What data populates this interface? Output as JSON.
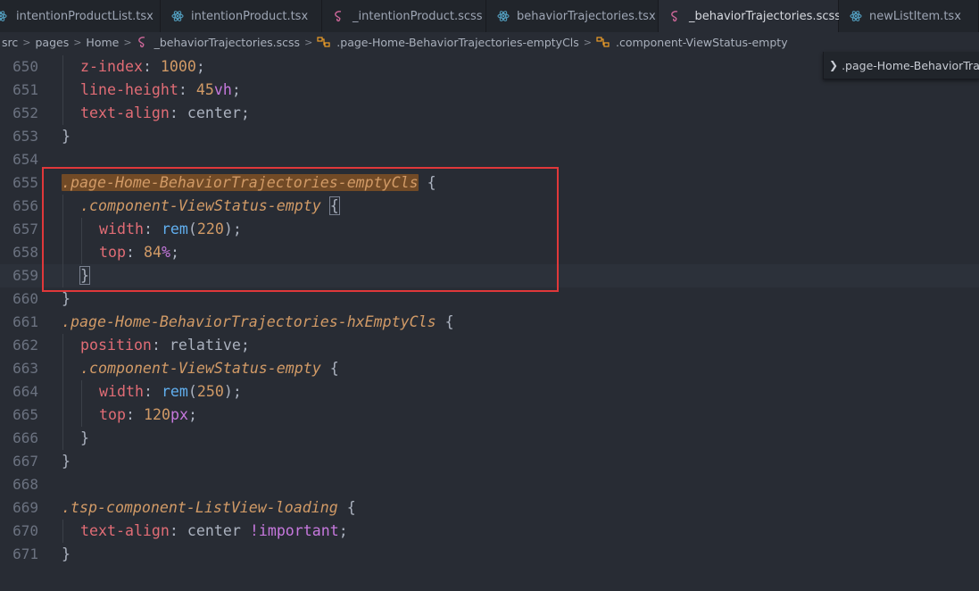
{
  "tabs": [
    {
      "label": "intentionProductList.tsx",
      "icon": "react-icon",
      "active": false
    },
    {
      "label": "intentionProduct.tsx",
      "icon": "react-icon",
      "active": false
    },
    {
      "label": "_intentionProduct.scss",
      "icon": "sass-icon",
      "active": false
    },
    {
      "label": "behaviorTrajectories.tsx",
      "icon": "react-icon",
      "active": false
    },
    {
      "label": "_behaviorTrajectories.scss",
      "icon": "sass-icon",
      "active": true,
      "close": "✕"
    },
    {
      "label": "newListItem.tsx",
      "icon": "react-icon",
      "active": false
    }
  ],
  "breadcrumb": {
    "items": [
      "src",
      "pages",
      "Home",
      "_behaviorTrajectories.scss",
      ".page-Home-BehaviorTrajectories-emptyCls",
      ".component-ViewStatus-empty"
    ],
    "separator": ">"
  },
  "sticky_scroll": {
    "text": ".page-Home-BehaviorTrajectories-emptyCls"
  },
  "editor": {
    "line_numbers": [
      "650",
      "651",
      "652",
      "653",
      "654",
      "655",
      "656",
      "657",
      "658",
      "659",
      "660",
      "661",
      "662",
      "663",
      "664",
      "665",
      "666",
      "667",
      "668",
      "669",
      "670",
      "671"
    ],
    "lines": {
      "l650": {
        "prop": "z-index",
        "num": "1000"
      },
      "l651": {
        "prop": "line-height",
        "num": "45",
        "unit": "vh"
      },
      "l652": {
        "prop": "text-align",
        "val": "center"
      },
      "l653": {
        "close": "}"
      },
      "l655": {
        "selector": ".page-Home-BehaviorTrajectories-emptyCls",
        "open": "{"
      },
      "l656": {
        "selector": ".component-ViewStatus-empty",
        "open": "{"
      },
      "l657": {
        "prop": "width",
        "func": "rem",
        "num": "220"
      },
      "l658": {
        "prop": "top",
        "num": "84",
        "unit": "%"
      },
      "l659": {
        "close": "}"
      },
      "l660": {
        "close": "}"
      },
      "l661": {
        "selector": ".page-Home-BehaviorTrajectories-hxEmptyCls",
        "open": "{"
      },
      "l662": {
        "prop": "position",
        "val": "relative"
      },
      "l663": {
        "selector": ".component-ViewStatus-empty",
        "open": "{"
      },
      "l664": {
        "prop": "width",
        "func": "rem",
        "num": "250"
      },
      "l665": {
        "prop": "top",
        "num": "120",
        "unit": "px"
      },
      "l666": {
        "close": "}"
      },
      "l667": {
        "close": "}"
      },
      "l669": {
        "selector": ".tsp-component-ListView-loading",
        "open": "{"
      },
      "l670": {
        "prop": "text-align",
        "val": "center",
        "important": "!important"
      },
      "l671": {
        "close": "}"
      }
    }
  },
  "colors": {
    "editor_bg": "#282c34",
    "property": "#e06c75",
    "number": "#d19a66",
    "unit": "#c678dd",
    "function": "#61afef",
    "selector": "#d19a66",
    "selection_highlight": "#714a26",
    "annotation_box": "#e0383a"
  }
}
